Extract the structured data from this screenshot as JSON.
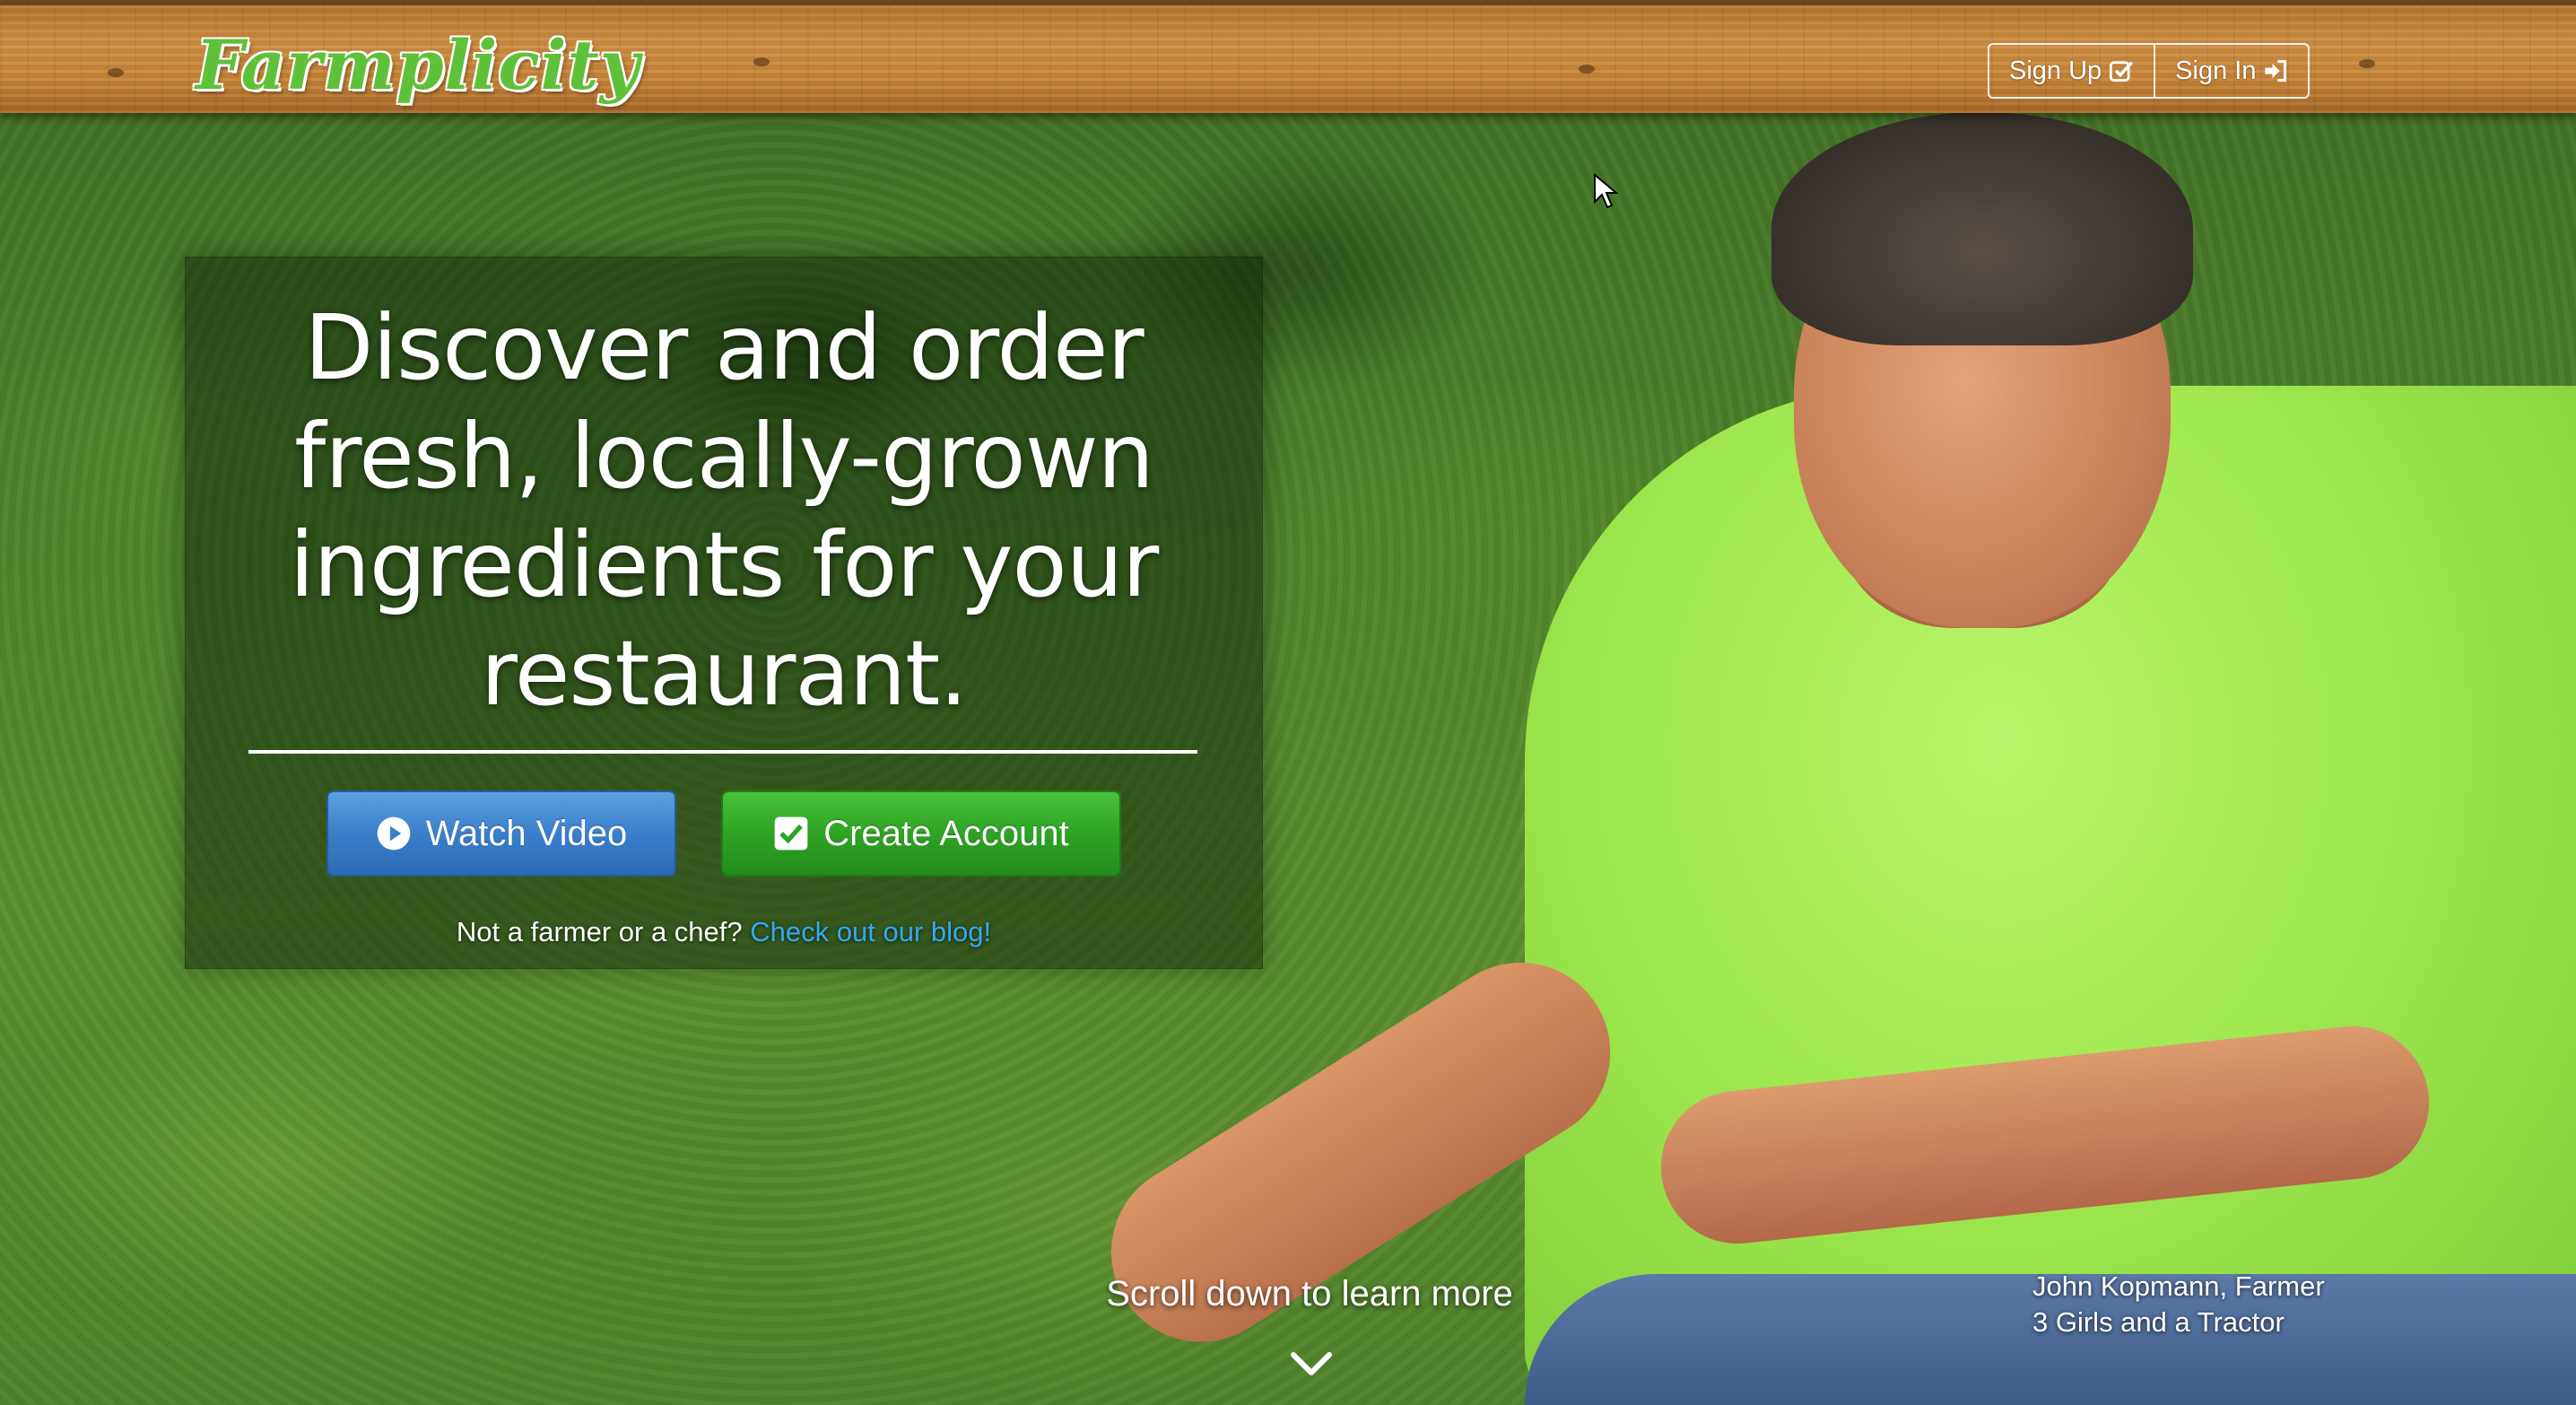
{
  "brand": {
    "logo_text": "Farmplicity",
    "accent_green": "#5fc13a"
  },
  "nav": {
    "signup_label": "Sign Up",
    "signup_icon": "check-square-icon",
    "signin_label": "Sign In",
    "signin_icon": "sign-in-icon"
  },
  "hero": {
    "headline": "Discover and order fresh, locally-grown ingredients for your restaurant.",
    "watch_video_label": "Watch Video",
    "watch_video_icon": "play-circle-icon",
    "create_account_label": "Create Account",
    "create_account_icon": "check-square-icon",
    "blog_prompt": "Not a farmer or a chef?",
    "blog_link": "Check out our blog!",
    "colors": {
      "blue_button": "#3b7fcb",
      "green_button": "#2ea324",
      "link": "#33aaf0"
    }
  },
  "footer_hint": {
    "scroll_text": "Scroll down to learn more",
    "chevron_icon": "chevron-down-icon"
  },
  "photo_caption": {
    "line1": "John Kopmann, Farmer",
    "line2": "3 Girls and a Tractor"
  }
}
